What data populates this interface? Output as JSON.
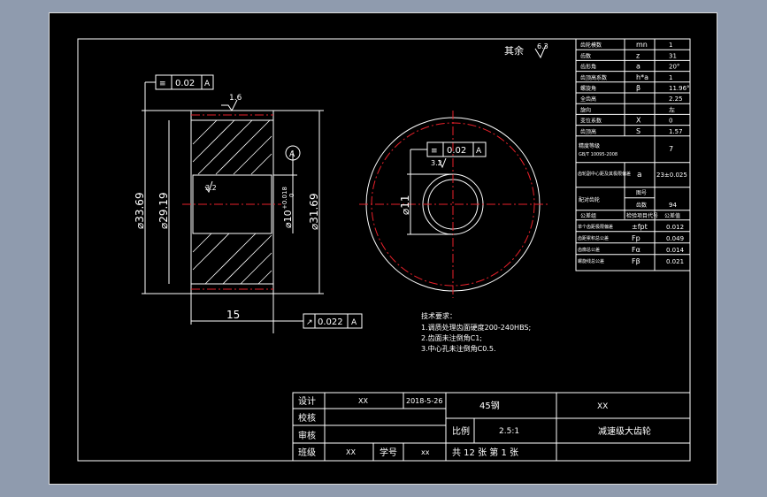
{
  "viewport": {
    "background": "#000000",
    "frame_color": "#ffffff",
    "center_line_color": "#e8202a"
  },
  "surface_finish": {
    "label": "其余",
    "value": "6.3"
  },
  "side_view": {
    "dims": {
      "od": "⌀33.69",
      "tip": "⌀29.19",
      "shaft": "⌀31.69",
      "width": "15",
      "bore": "⌀10",
      "tol_upper": "+0.018",
      "tol_lower": "0",
      "roughness_top": "1.6",
      "roughness_bore": "3.2"
    },
    "flatness_frame": {
      "value": "0.02",
      "datum": "A"
    },
    "runout_frame": {
      "value": "0.022",
      "datum": "A"
    },
    "datum_label": "A"
  },
  "front_view": {
    "dim_bore": "⌀11",
    "flatness_frame": {
      "value": "0.02",
      "datum": "A"
    },
    "roughness": "3.2"
  },
  "param_table": [
    [
      "齿轮模数",
      "mn",
      "1"
    ],
    [
      "齿数",
      "z",
      "31"
    ],
    [
      "齿形角",
      "a",
      "20°"
    ],
    [
      "齿顶高系数",
      "h*a",
      "1"
    ],
    [
      "螺旋角",
      "β",
      "11.96°"
    ],
    [
      "全齿高",
      "",
      "2.25"
    ],
    [
      "旋向",
      "",
      "左"
    ],
    [
      "变位系数",
      "X",
      "0"
    ],
    [
      "齿顶高",
      "S",
      "1.57"
    ]
  ],
  "param_accuracy": {
    "label": "精度等级",
    "sub": "GB/T 10095-2008",
    "value": "7"
  },
  "param_center": {
    "label": "齿轮副中心距及其极限偏差",
    "symbol": "a",
    "value": "23±0.025"
  },
  "param_mate": {
    "label": "配对齿轮",
    "row1": "图号",
    "row2": "齿数",
    "value": "94"
  },
  "param_head": {
    "c1": "公差组",
    "c2": "检验项目代号",
    "c3": "公差值"
  },
  "param_tol": [
    [
      "单个齿距极限偏差",
      "±fpt",
      "0.012"
    ],
    [
      "齿距累积总公差",
      "Fp",
      "0.049"
    ],
    [
      "齿廓总公差",
      "Fα",
      "0.014"
    ],
    [
      "螺旋线总公差",
      "Fβ",
      "0.021"
    ]
  ],
  "notes": {
    "title": "技术要求：",
    "items": [
      "1.调质处理齿面硬度200-240HBS;",
      "2.齿面未注倒角C1;",
      "3.中心孔未注倒角C0.5."
    ]
  },
  "title_block": {
    "design": "设计",
    "design_name": "XX",
    "date": "2018-5-26",
    "check": "校核",
    "approve": "审核",
    "cls": "班级",
    "cls_name": "XX",
    "student_id": "学号",
    "student_val": "xx",
    "material": "45钢",
    "school": "XX",
    "scale_label": "比例",
    "scale": "2.5:1",
    "part_name": "减速级大齿轮",
    "sheets": "共 12 张  第 1 张"
  }
}
